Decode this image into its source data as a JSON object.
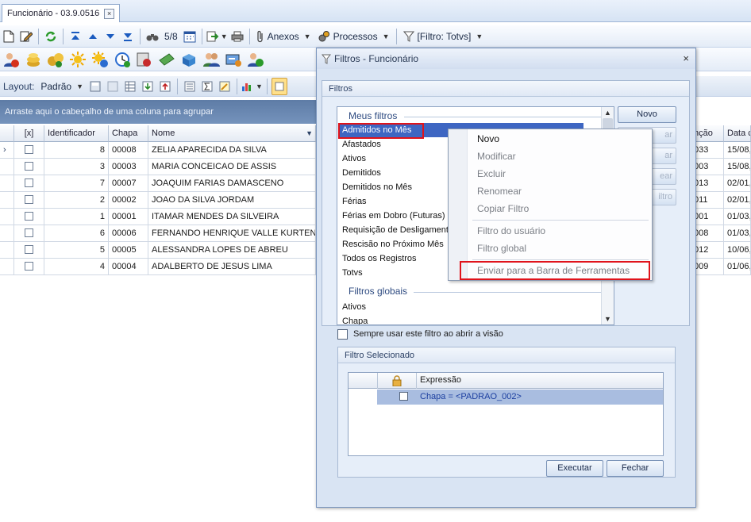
{
  "tab": {
    "title": "Funcionário - 03.9.0516",
    "close": "×"
  },
  "toolbar1": {
    "record_counter": "5/8",
    "anexos": "Anexos",
    "processos": "Processos",
    "filter_label": "[Filtro: Totvs]"
  },
  "toolbar3": {
    "layout_label": "Layout:",
    "layout_value": "Padrão"
  },
  "group_hint": "Arraste aqui o cabeçalho de uma coluna para agrupar",
  "grid": {
    "headers": {
      "x": "[x]",
      "id": "Identificador",
      "chapa": "Chapa",
      "nome": "Nome",
      "funcao": "nção",
      "data": "Data c"
    },
    "rows": [
      {
        "id": "8",
        "chapa": "00008",
        "nome": "ZELIA APARECIDA DA SILVA",
        "funcao": "033",
        "data": "15/08,"
      },
      {
        "id": "3",
        "chapa": "00003",
        "nome": "MARIA CONCEICAO DE ASSIS",
        "funcao": "003",
        "data": "15/08,"
      },
      {
        "id": "7",
        "chapa": "00007",
        "nome": "JOAQUIM FARIAS DAMASCENO",
        "funcao": "013",
        "data": "02/01,"
      },
      {
        "id": "2",
        "chapa": "00002",
        "nome": "JOAO DA SILVA JORDAM",
        "funcao": "011",
        "data": "02/01,"
      },
      {
        "id": "1",
        "chapa": "00001",
        "nome": "ITAMAR MENDES DA SILVEIRA",
        "funcao": "001",
        "data": "01/03,"
      },
      {
        "id": "6",
        "chapa": "00006",
        "nome": "FERNANDO HENRIQUE VALLE KURTEN",
        "funcao": "008",
        "data": "01/03,"
      },
      {
        "id": "5",
        "chapa": "00005",
        "nome": "ALESSANDRA LOPES DE ABREU",
        "funcao": "012",
        "data": "10/06,"
      },
      {
        "id": "4",
        "chapa": "00004",
        "nome": "ADALBERTO DE JESUS LIMA",
        "funcao": "009",
        "data": "01/06,"
      }
    ]
  },
  "dialog": {
    "title": "Filtros - Funcionário",
    "close": "×",
    "filtros_group": "Filtros",
    "meus_filtros": "Meus filtros",
    "my_filters": [
      "Admitidos no Mês",
      "Afastados",
      "Ativos",
      "Demitidos",
      "Demitidos no Mês",
      "Férias",
      "Férias em Dobro (Futuras)",
      "Requisição de Desligamento",
      "Rescisão no Próximo Mês",
      "Todos os Registros",
      "Totvs"
    ],
    "filtros_globais": "Filtros globais",
    "global_filters": [
      "Ativos",
      "Chapa"
    ],
    "buttons": {
      "novo": "Novo",
      "modificar": "ar",
      "excluir": "ar",
      "renomear": "ear",
      "copiar": "iltro"
    },
    "always_use": "Sempre usar este filtro ao abrir a visão",
    "selected_group": "Filtro Selecionado",
    "expr_header": "Expressão",
    "expr_value": "Chapa = <PADRAO_002>",
    "executar": "Executar",
    "fechar": "Fechar"
  },
  "context_menu": {
    "items": {
      "novo": "Novo",
      "modificar": "Modificar",
      "excluir": "Excluir",
      "renomear": "Renomear",
      "copiar": "Copiar Filtro",
      "usuario": "Filtro do usuário",
      "global": "Filtro global",
      "enviar": "Enviar para a Barra de Ferramentas"
    }
  }
}
